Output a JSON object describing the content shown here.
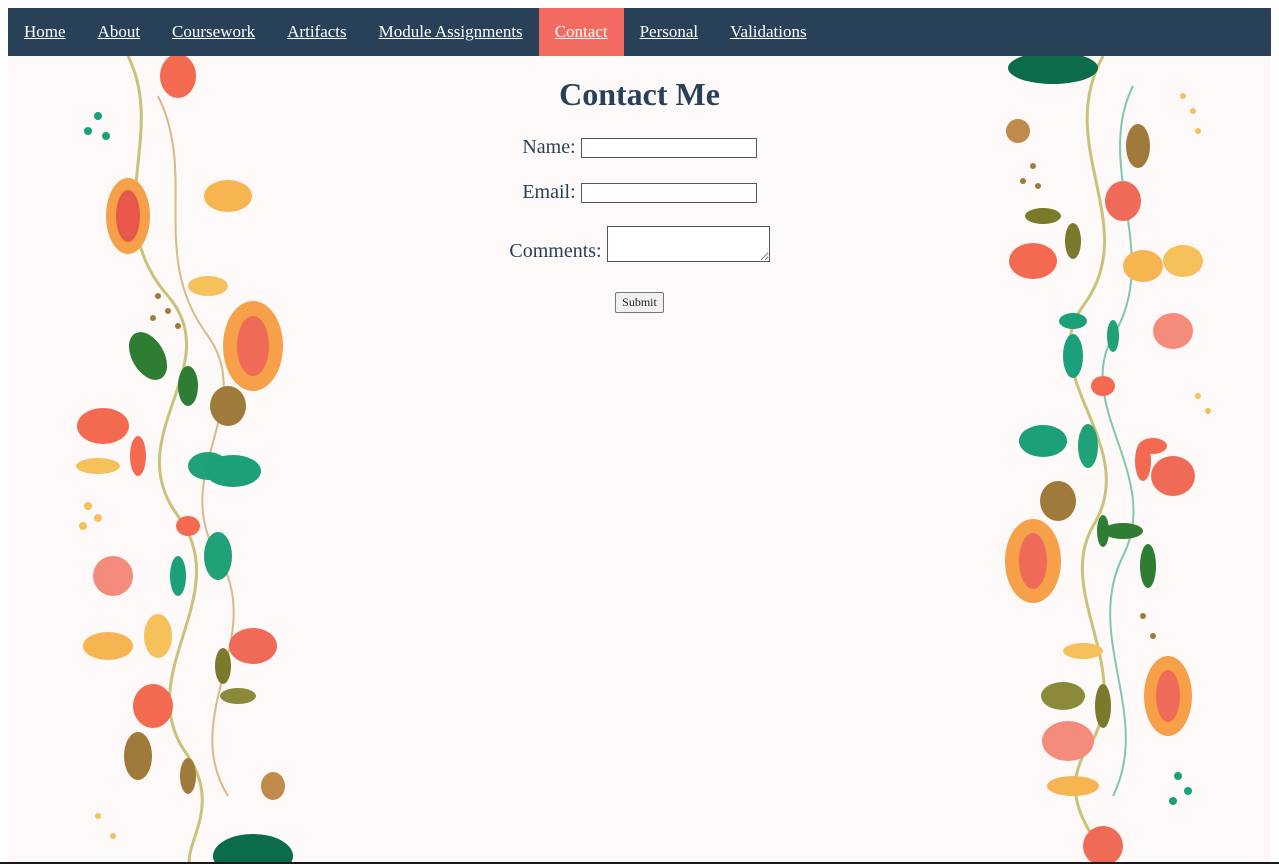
{
  "nav": {
    "items": [
      {
        "label": "Home"
      },
      {
        "label": "About"
      },
      {
        "label": "Coursework"
      },
      {
        "label": "Artifacts"
      },
      {
        "label": "Module Assignments"
      },
      {
        "label": "Contact",
        "active": true
      },
      {
        "label": "Personal"
      },
      {
        "label": "Validations"
      }
    ]
  },
  "page": {
    "title": "Contact Me"
  },
  "form": {
    "name_label": "Name:",
    "name_value": "",
    "email_label": "Email:",
    "email_value": "",
    "comments_label": "Comments:",
    "comments_value": "",
    "submit_label": "Submit"
  },
  "colors": {
    "nav_bg": "#284159",
    "nav_active": "#f36a61",
    "text": "#284159",
    "page_bg": "#fcf9f8"
  },
  "background": {
    "pattern": "floral-vine-border"
  }
}
